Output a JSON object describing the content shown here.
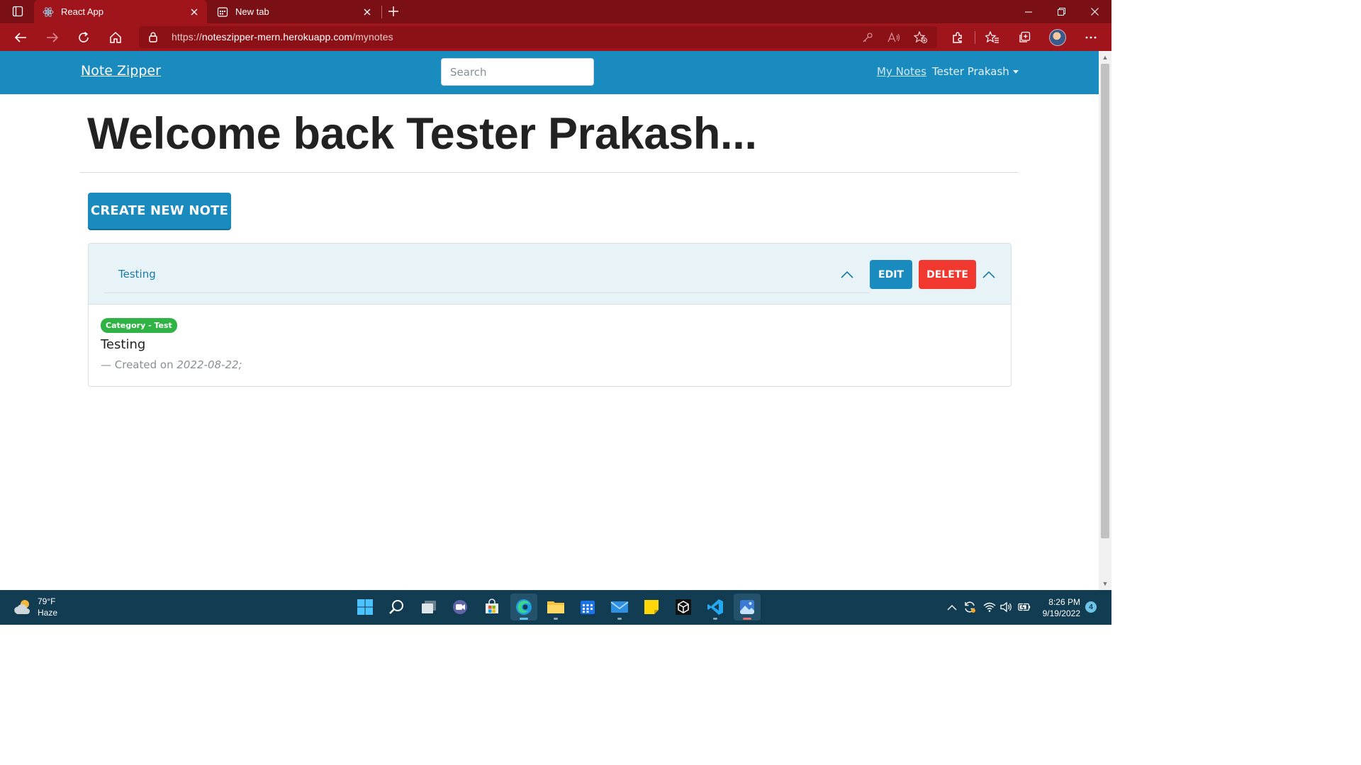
{
  "browser": {
    "tabs": [
      {
        "title": "React App",
        "active": true,
        "icon": "react-icon"
      },
      {
        "title": "New tab",
        "active": false,
        "icon": "new-tab-page-icon"
      }
    ],
    "address": {
      "scheme": "https://",
      "host": "noteszipper-mern.herokuapp.com",
      "path": "/mynotes"
    },
    "accent": "#a0151c"
  },
  "navbar": {
    "brand": "Note Zipper",
    "search_placeholder": "Search",
    "my_notes": "My Notes",
    "user_name": "Tester Prakash",
    "color": "#1a8bbf"
  },
  "page": {
    "welcome": "Welcome back Tester Prakash...",
    "create_button": "CREATE NEW NOTE"
  },
  "notes": [
    {
      "title": "Testing",
      "edit_label": "EDIT",
      "delete_label": "DELETE",
      "category_badge": "Category - Test",
      "content": "Testing",
      "footer_prefix": "— Created on",
      "created_on": "2022-08-22;"
    }
  ],
  "taskbar": {
    "weather_temp": "79°F",
    "weather_desc": "Haze",
    "time": "8:26 PM",
    "date": "9/19/2022",
    "notification_count": "4",
    "apps": [
      "start-icon",
      "search-icon",
      "task-view-icon",
      "teams-chat-icon",
      "microsoft-store-icon",
      "edge-icon",
      "file-explorer-icon",
      "calendar-icon",
      "mail-icon",
      "sticky-notes-icon",
      "unity-icon",
      "vscode-icon",
      "photos-icon"
    ]
  }
}
